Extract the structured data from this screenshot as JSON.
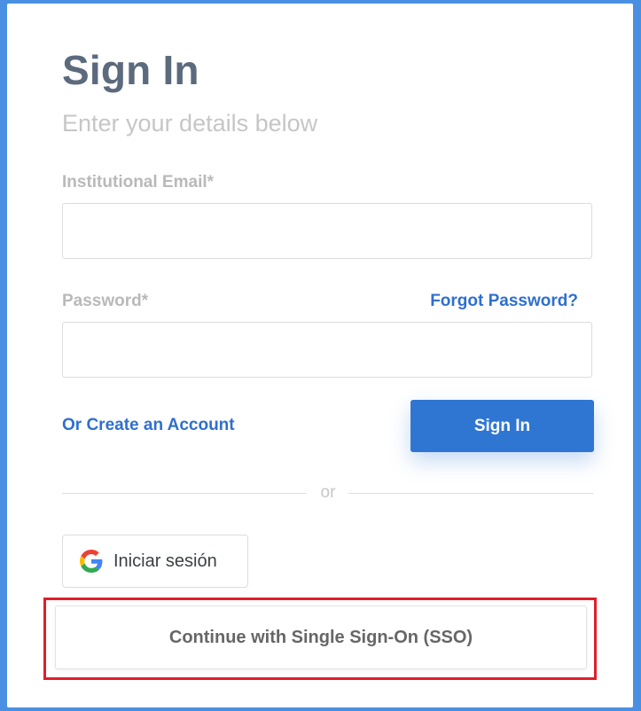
{
  "header": {
    "title": "Sign In",
    "subtitle": "Enter your details below"
  },
  "form": {
    "email_label": "Institutional Email*",
    "email_value": "",
    "password_label": "Password*",
    "password_value": "",
    "forgot_password": "Forgot Password?",
    "create_account": "Or Create an Account",
    "sign_in_button": "Sign In"
  },
  "divider": {
    "text": "or"
  },
  "social": {
    "google_button": "Iniciar sesión",
    "google_icon": "google-g-icon",
    "sso_button": "Continue with Single Sign-On (SSO)"
  },
  "colors": {
    "page_background": "#4a90e2",
    "accent": "#2f76d3",
    "link": "#2f6fce",
    "title": "#5c6a7e",
    "highlight": "#e01e2b"
  }
}
